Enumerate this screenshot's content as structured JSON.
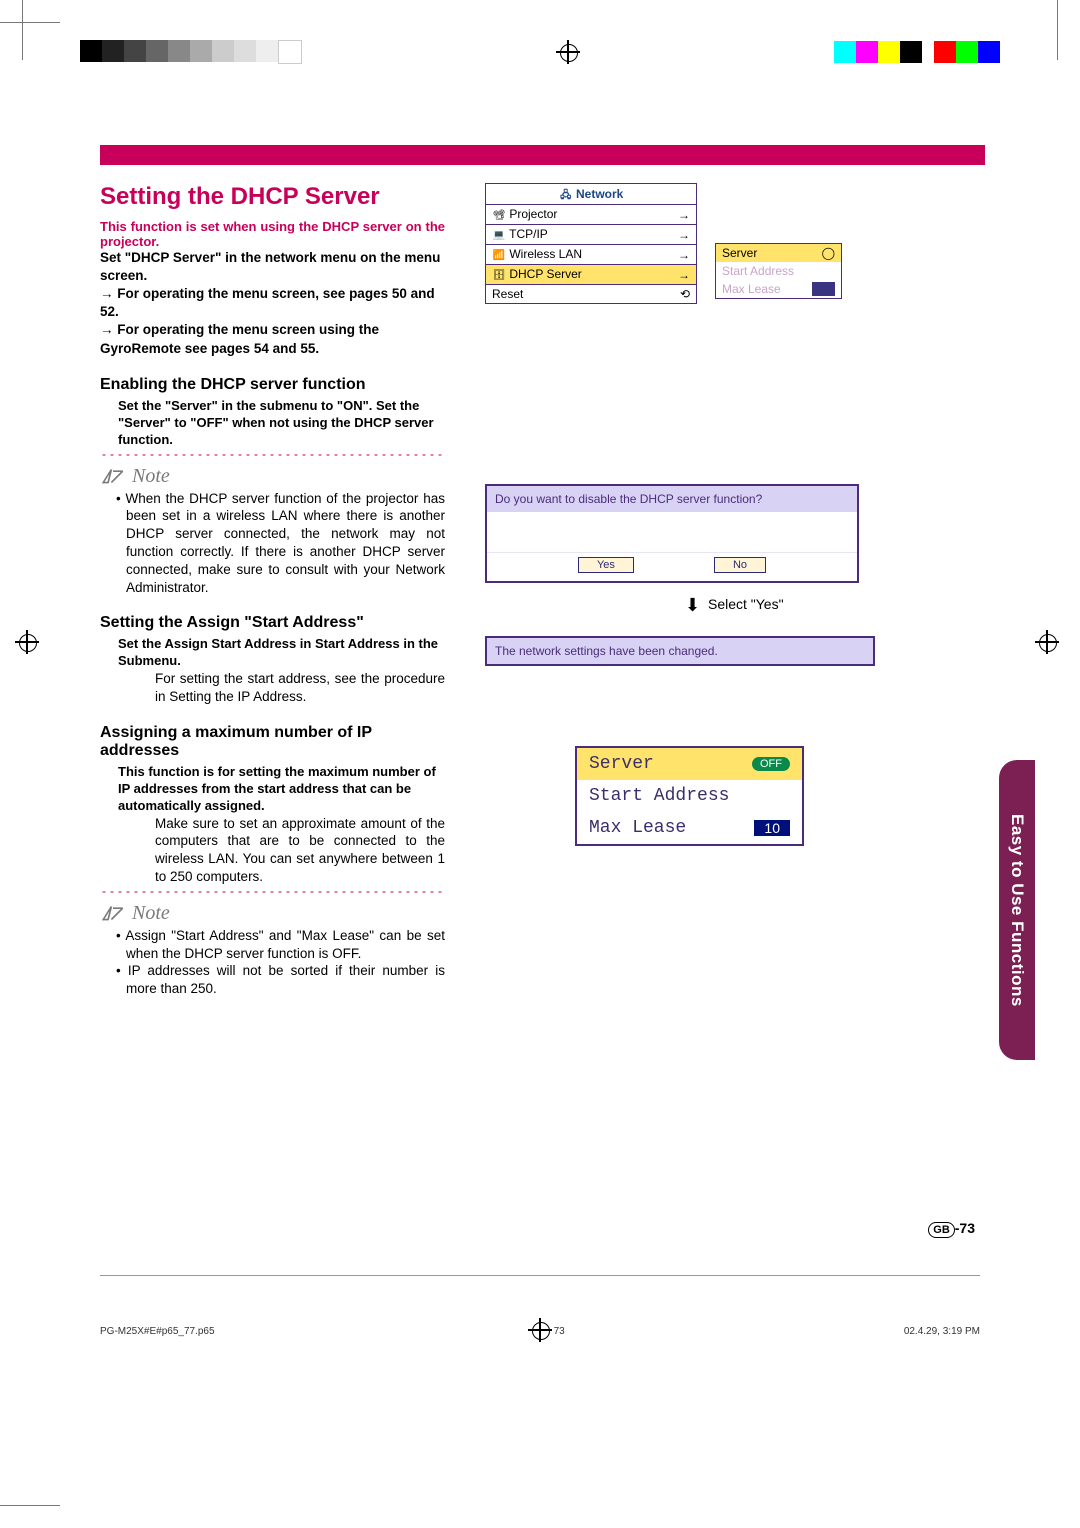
{
  "title": "Setting the DHCP Server",
  "intro": "This function is set when using the DHCP server on the projector.",
  "body1": "Set \"DHCP Server\" in the network menu on the menu screen.",
  "body2": "→ For operating the menu screen, see pages 50 and 52.",
  "body3": "→ For operating the menu screen using the GyroRemote see pages 54 and 55.",
  "sec1": {
    "h": "Enabling the DHCP server function",
    "sub": "Set the \"Server\" in the submenu to \"ON\". Set the \"Server\" to \"OFF\" when not using the DHCP server function."
  },
  "note_label": "Note",
  "note1": "• When the DHCP server function of the projector has been set in a wireless LAN where there is another DHCP server connected, the network may not function correctly. If there is another DHCP server connected, make sure to consult with your Network Administrator.",
  "sec2": {
    "h": "Setting the Assign \"Start Address\"",
    "sub": "Set the Assign Start Address in Start Address in the Submenu.",
    "body": "For setting the start address, see the procedure in Setting the IP Address."
  },
  "sec3": {
    "h": "Assigning a maximum number of IP addresses",
    "sub": "This function is for setting the maximum number of IP addresses from the start address that can be automatically assigned.",
    "body": "Make sure to set an approximate amount of the computers that are to be connected to the wireless LAN. You can set anywhere between 1 to 250 computers."
  },
  "note2a": "• Assign \"Start Address\" and \"Max Lease\" can be set when the DHCP server function is OFF.",
  "note2b": "• IP addresses will not be sorted if their number is more than 250.",
  "menu": {
    "title": "Network",
    "items": [
      "Projector",
      "TCP/IP",
      "Wireless LAN",
      "DHCP Server",
      "Reset"
    ]
  },
  "side_menu": {
    "server": "Server",
    "start": "Start Address",
    "max": "Max Lease"
  },
  "dialog": {
    "q": "Do you want to disable the DHCP server function?",
    "yes": "Yes",
    "no": "No"
  },
  "select_yes": "Select \"Yes\"",
  "confirm": "The network settings have been changed.",
  "submenu": {
    "server": "Server",
    "off": "OFF",
    "start": "Start Address",
    "max": "Max Lease",
    "val": "10"
  },
  "side_tab": "Easy to Use Functions",
  "page_code": "GB",
  "page_num": "-73",
  "footer": {
    "file": "PG-M25X#E#p65_77.p65",
    "pg": "73",
    "date": "02.4.29, 3:19 PM"
  }
}
